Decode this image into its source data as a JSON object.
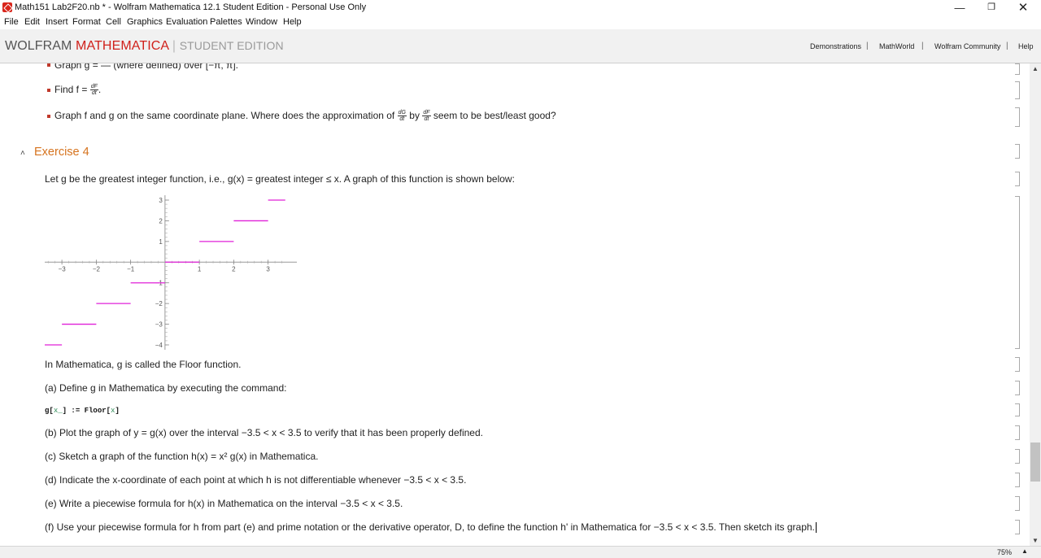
{
  "window": {
    "title": "Math151 Lab2F20.nb * - Wolfram Mathematica 12.1 Student Edition - Personal Use Only",
    "minimize": "—",
    "restore": "❐",
    "close": "✕"
  },
  "menu": [
    "File",
    "Edit",
    "Insert",
    "Format",
    "Cell",
    "Graphics",
    "Evaluation",
    "Palettes",
    "Window",
    "Help"
  ],
  "brand": {
    "wolfram": "WOLFRAM",
    "mathematica": "MATHEMATICA",
    "separator": "|",
    "edition": "STUDENT EDITION"
  },
  "links": [
    "Demonstrations",
    "MathWorld",
    "Wolfram Community",
    "Help"
  ],
  "link_separator": "|",
  "notebook": {
    "top_line": "Graph g = — (where defined) over [−π, π].",
    "bullet_find": "Find f =",
    "bullet_graph_a": "Graph f and g on the same coordinate plane. Where does the approximation of",
    "bullet_graph_b": "by",
    "bullet_graph_c": "seem to be best/least good?",
    "frac_dF_num": "dF",
    "frac_dG_num": "dG",
    "frac_den": "dt",
    "section_caret": "˄",
    "section_title": "Exercise 4",
    "intro": "Let g be the greatest integer function, i.e., g(x) = greatest integer ≤ x. A graph of this function is shown below:",
    "floor_note": "In Mathematica, g is called the Floor function.",
    "part_a": "(a) Define g in Mathematica by executing the command:",
    "code_head": "g[",
    "code_var1": "x_",
    "code_mid": "] := Floor[",
    "code_var2": "x",
    "code_tail": "]",
    "part_b": "(b) Plot the graph of y = g(x) over the interval −3.5 < x < 3.5 to verify that it has been properly defined.",
    "part_c": "(c) Sketch a graph of the function h(x) = x² g(x) in Mathematica.",
    "part_d": "(d) Indicate the x-coordinate of each point at which h is not differentiable whenever −3.5 < x < 3.5.",
    "part_e": "(e) Write a piecewise formula for h(x) in Mathematica on the interval −3.5 < x < 3.5.",
    "part_f": "(f) Use your piecewise formula for h from part (e) and prime notation or the derivative operator, D, to define the function h' in Mathematica for −3.5 < x < 3.5. Then sketch its graph."
  },
  "chart_data": {
    "type": "line",
    "title": "",
    "xlabel": "",
    "ylabel": "",
    "x_ticks": [
      "-3",
      "-2",
      "-1",
      "1",
      "2",
      "3"
    ],
    "y_ticks": [
      "3",
      "2",
      "1",
      "-1",
      "-2",
      "-3",
      "-4"
    ],
    "xlim": [
      -3.5,
      3.6
    ],
    "ylim": [
      -4,
      3
    ],
    "series": [
      {
        "color": "#e020d8",
        "segments": [
          {
            "x0": -3.5,
            "x1": -3,
            "y": -4
          },
          {
            "x0": -3,
            "x1": -2,
            "y": -3
          },
          {
            "x0": -2,
            "x1": -1,
            "y": -2
          },
          {
            "x0": -1,
            "x1": 0,
            "y": -1
          },
          {
            "x0": 0,
            "x1": 1,
            "y": 0
          },
          {
            "x0": 1,
            "x1": 2,
            "y": 1
          },
          {
            "x0": 2,
            "x1": 3,
            "y": 2
          },
          {
            "x0": 3,
            "x1": 3.5,
            "y": 3
          }
        ]
      }
    ]
  },
  "status": {
    "zoom": "75%",
    "zoom_caret": "▲"
  },
  "scroll": {
    "up": "▲",
    "down": "▼"
  }
}
